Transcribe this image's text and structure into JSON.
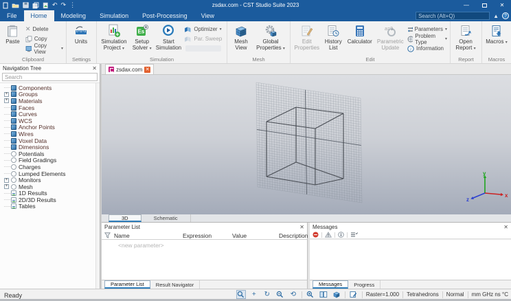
{
  "window": {
    "title": "zsdax.com - CST Studio Suite 2023",
    "search_placeholder": "Search (Alt+Q)"
  },
  "menu_tabs": [
    {
      "label": "File",
      "active": false
    },
    {
      "label": "Home",
      "active": true
    },
    {
      "label": "Modeling",
      "active": false
    },
    {
      "label": "Simulation",
      "active": false
    },
    {
      "label": "Post-Processing",
      "active": false
    },
    {
      "label": "View",
      "active": false
    }
  ],
  "ribbon": {
    "clipboard": {
      "label": "Clipboard",
      "paste": "Paste",
      "delete": "Delete",
      "copy": "Copy",
      "copy_view": "Copy View"
    },
    "settings": {
      "label": "Settings",
      "units": "Units"
    },
    "simulation": {
      "label": "Simulation",
      "simulation_project": "Simulation Project",
      "setup_solver": "Setup Solver",
      "start_simulation": "Start Simulation",
      "optimizer": "Optimizer",
      "par_sweep": "Par. Sweep"
    },
    "mesh": {
      "label": "Mesh",
      "mesh_view": "Mesh View",
      "global_properties": "Global Properties"
    },
    "edit": {
      "label": "Edit",
      "edit_properties": "Edit Properties",
      "history_list": "History List",
      "calculator": "Calculator",
      "parametric_update": "Parametric Update",
      "parameters": "Parameters",
      "problem_type": "Problem Type",
      "information": "Information"
    },
    "report": {
      "label": "Report",
      "open_report": "Open Report"
    },
    "macros": {
      "label": "Macros",
      "macros": "Macros"
    }
  },
  "nav_tree": {
    "title": "Navigation Tree",
    "search_placeholder": "Search",
    "items": [
      {
        "label": "Components",
        "icon": "components-icon",
        "expandable": false
      },
      {
        "label": "Groups",
        "icon": "groups-icon",
        "expandable": true
      },
      {
        "label": "Materials",
        "icon": "materials-icon",
        "expandable": true
      },
      {
        "label": "Faces",
        "icon": "faces-icon",
        "expandable": false
      },
      {
        "label": "Curves",
        "icon": "curves-icon",
        "expandable": false
      },
      {
        "label": "WCS",
        "icon": "wcs-icon",
        "expandable": false
      },
      {
        "label": "Anchor Points",
        "icon": "anchor-points-icon",
        "expandable": false
      },
      {
        "label": "Wires",
        "icon": "wires-icon",
        "expandable": false
      },
      {
        "label": "Voxel Data",
        "icon": "voxel-data-icon",
        "expandable": false
      },
      {
        "label": "Dimensions",
        "icon": "dimensions-icon",
        "expandable": false
      },
      {
        "label": "Potentials",
        "icon": "potentials-icon",
        "expandable": false
      },
      {
        "label": "Field Gradings",
        "icon": "field-gradings-icon",
        "expandable": false
      },
      {
        "label": "Charges",
        "icon": "charges-icon",
        "expandable": false
      },
      {
        "label": "Lumped Elements",
        "icon": "lumped-elements-icon",
        "expandable": false
      },
      {
        "label": "Monitors",
        "icon": "monitors-icon",
        "expandable": true
      },
      {
        "label": "Mesh",
        "icon": "mesh-icon",
        "expandable": true
      },
      {
        "label": "1D Results",
        "icon": "results-1d-icon",
        "expandable": false
      },
      {
        "label": "2D/3D Results",
        "icon": "results-2d3d-icon",
        "expandable": false
      },
      {
        "label": "Tables",
        "icon": "tables-icon",
        "expandable": false
      }
    ]
  },
  "document_tab": {
    "label": "zsdax.com"
  },
  "view_tabs": [
    {
      "label": "3D",
      "active": true
    },
    {
      "label": "Schematic",
      "active": false
    }
  ],
  "viewport": {
    "axes": {
      "x": "x",
      "y": "y",
      "z": "z",
      "x_color": "#cc2222",
      "y_color": "#1fa51f",
      "z_color": "#2b3fd0"
    }
  },
  "parameter_panel": {
    "title": "Parameter List",
    "columns": [
      "Name",
      "Expression",
      "Value",
      "Description"
    ],
    "new_row": "<new parameter>",
    "tabs": [
      {
        "label": "Parameter List",
        "active": true
      },
      {
        "label": "Result Navigator",
        "active": false
      }
    ]
  },
  "messages_panel": {
    "title": "Messages",
    "tabs": [
      {
        "label": "Messages",
        "active": true
      },
      {
        "label": "Progress",
        "active": false
      }
    ]
  },
  "status_bar": {
    "ready": "Ready",
    "items": [
      "Raster=1.000",
      "Tetrahedrons",
      "Normal",
      "mm GHz ns °C"
    ]
  }
}
